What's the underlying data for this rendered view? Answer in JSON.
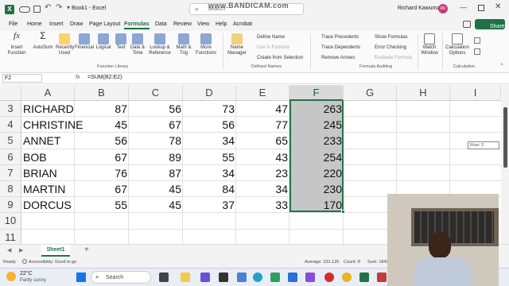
{
  "title": {
    "book": "Book1 - Excel",
    "search_placeholder": "Search",
    "user": "Richard Kawuma",
    "initials": "RK",
    "watermark": "www.BANDICAM.com"
  },
  "tabs": [
    "File",
    "Home",
    "Insert",
    "Draw",
    "Page Layout",
    "Formulas",
    "Data",
    "Review",
    "View",
    "Help",
    "Acrobat"
  ],
  "share": "Share",
  "ribbon": {
    "insert_function": "Insert Function",
    "autosum": "AutoSum",
    "recently_used": "Recently Used",
    "financial": "Financial",
    "logical": "Logical",
    "text": "Text",
    "date_time": "Date & Time",
    "lookup": "Lookup & Reference",
    "math": "Math & Trig",
    "more": "More Functions",
    "function_library": "Function Library",
    "name_manager": "Name Manager",
    "define_name": "Define Name",
    "use_in_formula": "Use in Formula",
    "create_from_selection": "Create from Selection",
    "defined_names": "Defined Names",
    "trace_precedents": "Trace Precedents",
    "trace_dependents": "Trace Dependents",
    "remove_arrows": "Remove Arrows",
    "show_formulas": "Show Formulas",
    "error_checking": "Error Checking",
    "evaluate_formula": "Evaluate Formula",
    "formula_auditing": "Formula Auditing",
    "watch_window": "Watch Window",
    "calc_options": "Calculation Options",
    "calculation": "Calculation"
  },
  "formula_bar": {
    "name_box": "F2",
    "fx": "fx",
    "formula": "=SUM(B2:E2)"
  },
  "columns": [
    "A",
    "B",
    "C",
    "D",
    "E",
    "F",
    "G",
    "H",
    "I"
  ],
  "rows": [
    {
      "n": "3",
      "name": "RICHARD",
      "b": "87",
      "c": "56",
      "d": "73",
      "e": "47",
      "f": "263"
    },
    {
      "n": "4",
      "name": "CHRISTINE",
      "b": "45",
      "c": "67",
      "d": "56",
      "e": "77",
      "f": "245"
    },
    {
      "n": "5",
      "name": "ANNET",
      "b": "56",
      "c": "78",
      "d": "34",
      "e": "65",
      "f": "233"
    },
    {
      "n": "6",
      "name": "BOB",
      "b": "67",
      "c": "89",
      "d": "55",
      "e": "43",
      "f": "254"
    },
    {
      "n": "7",
      "name": "BRIAN",
      "b": "76",
      "c": "87",
      "d": "34",
      "e": "23",
      "f": "220"
    },
    {
      "n": "8",
      "name": "MARTIN",
      "b": "67",
      "c": "45",
      "d": "84",
      "e": "34",
      "f": "230"
    },
    {
      "n": "9",
      "name": "DORCUS",
      "b": "55",
      "c": "45",
      "d": "37",
      "e": "33",
      "f": "170"
    },
    {
      "n": "10",
      "name": "",
      "b": "",
      "c": "",
      "d": "",
      "e": "",
      "f": ""
    },
    {
      "n": "11",
      "name": "",
      "b": "",
      "c": "",
      "d": "",
      "e": "",
      "f": ""
    }
  ],
  "scroll_tooltip": "Row: 3",
  "sheet": {
    "tab": "Sheet1",
    "add": "+"
  },
  "status": {
    "ready": "Ready",
    "accessibility": "Accessibility: Good to go",
    "average": "Average: 231.125",
    "count": "Count: 8",
    "sum": "Sum: 1849"
  },
  "taskbar": {
    "temp": "22°C",
    "weather": "Partly sunny",
    "search": "Search"
  },
  "colors": {
    "excel_green": "#217346",
    "share_green": "#1e7145",
    "selection": "#c6c6c6"
  }
}
